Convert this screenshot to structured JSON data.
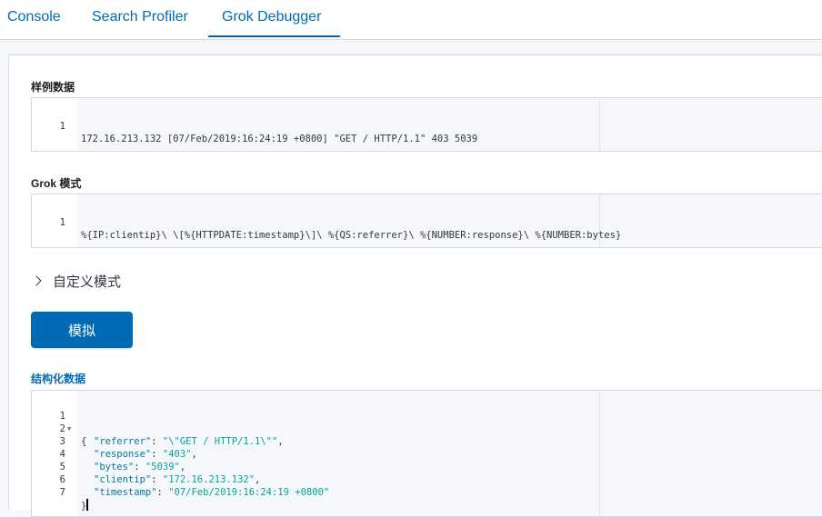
{
  "tabs": [
    {
      "label": "Console",
      "active": false
    },
    {
      "label": "Search Profiler",
      "active": false
    },
    {
      "label": "Grok Debugger",
      "active": true
    }
  ],
  "sample_data": {
    "label": "样例数据",
    "lines": [
      {
        "num": "1",
        "text": "172.16.213.132 [07/Feb/2019:16:24:19 +0800] \"GET / HTTP/1.1\" 403 5039"
      }
    ]
  },
  "grok_pattern": {
    "label": "Grok 模式",
    "lines": [
      {
        "num": "1",
        "text": "%{IP:clientip}\\ \\[%{HTTPDATE:timestamp}\\]\\ %{QS:referrer}\\ %{NUMBER:response}\\ %{NUMBER:bytes}"
      }
    ]
  },
  "custom_patterns": {
    "label": "自定义模式",
    "icon": "chevron-right-icon"
  },
  "simulate_button": {
    "label": "模拟"
  },
  "structured_data": {
    "label": "结构化数据",
    "line_numbers": [
      "1",
      "2",
      "3",
      "4",
      "5",
      "6",
      "7"
    ],
    "open_brace": "{",
    "close_brace": "}",
    "fields": [
      {
        "key": "\"referrer\"",
        "value": "\"\\\"GET / HTTP/1.1\\\"\"",
        "trail": ","
      },
      {
        "key": "\"response\"",
        "value": "\"403\"",
        "trail": ","
      },
      {
        "key": "\"bytes\"",
        "value": "\"5039\"",
        "trail": ","
      },
      {
        "key": "\"clientip\"",
        "value": "\"172.16.213.132\"",
        "trail": ","
      },
      {
        "key": "\"timestamp\"",
        "value": "\"07/Feb/2019:16:24:19 +0800\"",
        "trail": ""
      }
    ]
  },
  "colors": {
    "accent": "#006bb4",
    "json_key": "#0079a5",
    "json_string": "#00a69b"
  }
}
